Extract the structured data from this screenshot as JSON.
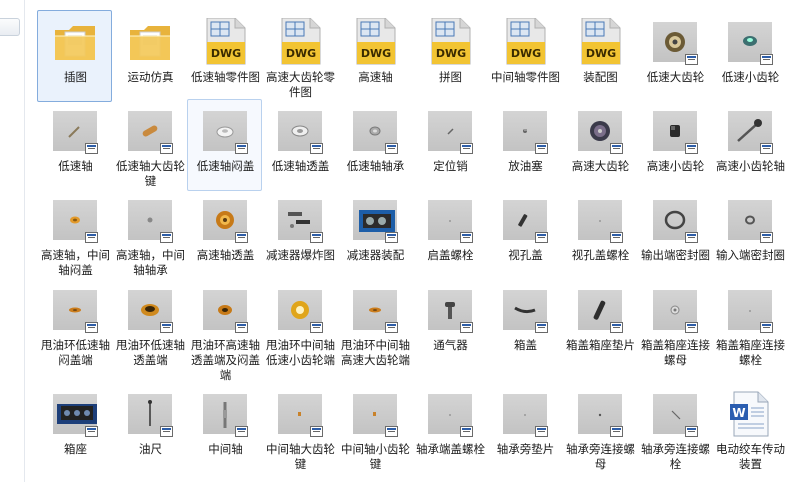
{
  "files": [
    {
      "label": "插图",
      "icon": "folder-icon",
      "kind": "folder"
    },
    {
      "label": "运动仿真",
      "icon": "folder-icon",
      "kind": "folder"
    },
    {
      "label": "低速轴零件图",
      "icon": "dwg-file-icon",
      "kind": "dwg"
    },
    {
      "label": "高速大齿轮零件图",
      "icon": "dwg-file-icon",
      "kind": "dwg"
    },
    {
      "label": "高速轴",
      "icon": "dwg-file-icon",
      "kind": "dwg"
    },
    {
      "label": "拼图",
      "icon": "dwg-file-icon",
      "kind": "dwg"
    },
    {
      "label": "中间轴零件图",
      "icon": "dwg-file-icon",
      "kind": "dwg"
    },
    {
      "label": "装配图",
      "icon": "dwg-file-icon",
      "kind": "dwg"
    },
    {
      "label": "低速大齿轮",
      "icon": "gear-part-icon",
      "kind": "part",
      "shape": "gear"
    },
    {
      "label": "低速小齿轮",
      "icon": "gear-part-icon",
      "kind": "part",
      "shape": "smallgear"
    },
    {
      "label": "低速轴",
      "icon": "shaft-part-icon",
      "kind": "part",
      "shape": "shaft"
    },
    {
      "label": "低速轴大齿轮键",
      "icon": "key-part-icon",
      "kind": "part",
      "shape": "key"
    },
    {
      "label": "低速轴闷盖",
      "icon": "cap-part-icon",
      "kind": "part",
      "shape": "cap"
    },
    {
      "label": "低速轴透盖",
      "icon": "cap-part-icon",
      "kind": "part",
      "shape": "ring"
    },
    {
      "label": "低速轴轴承",
      "icon": "bearing-part-icon",
      "kind": "part",
      "shape": "bearing"
    },
    {
      "label": "定位销",
      "icon": "pin-part-icon",
      "kind": "part",
      "shape": "pin"
    },
    {
      "label": "放油塞",
      "icon": "plug-part-icon",
      "kind": "part",
      "shape": "plug"
    },
    {
      "label": "高速大齿轮",
      "icon": "gear-part-icon",
      "kind": "part",
      "shape": "gear2"
    },
    {
      "label": "高速小齿轮",
      "icon": "gear-part-icon",
      "kind": "part",
      "shape": "block"
    },
    {
      "label": "高速小齿轮轴",
      "icon": "shaft-part-icon",
      "kind": "part",
      "shape": "gearshaft"
    },
    {
      "label": "高速轴，中间轴闷盖",
      "icon": "cap-part-icon",
      "kind": "part",
      "shape": "orangedot"
    },
    {
      "label": "高速轴，中间轴轴承",
      "icon": "bearing-part-icon",
      "kind": "part",
      "shape": "smalldot"
    },
    {
      "label": "高速轴透盖",
      "icon": "cap-part-icon",
      "kind": "part",
      "shape": "orangering"
    },
    {
      "label": "减速器爆炸图",
      "icon": "assembly-icon",
      "kind": "part",
      "shape": "explode"
    },
    {
      "label": "减速器装配",
      "icon": "assembly-icon",
      "kind": "part",
      "shape": "assembly"
    },
    {
      "label": "启盖螺栓",
      "icon": "bolt-part-icon",
      "kind": "part",
      "shape": "tiny"
    },
    {
      "label": "视孔盖",
      "icon": "cover-part-icon",
      "kind": "part",
      "shape": "slash"
    },
    {
      "label": "视孔盖螺栓",
      "icon": "bolt-part-icon",
      "kind": "part",
      "shape": "tiny"
    },
    {
      "label": "输出端密封圈",
      "icon": "seal-part-icon",
      "kind": "part",
      "shape": "seal"
    },
    {
      "label": "输入端密封圈",
      "icon": "seal-part-icon",
      "kind": "part",
      "shape": "sealsmall"
    },
    {
      "label": "甩油环低速轴闷盖端",
      "icon": "ring-part-icon",
      "kind": "part",
      "shape": "orangeflat"
    },
    {
      "label": "甩油环低速轴透盖端",
      "icon": "ring-part-icon",
      "kind": "part",
      "shape": "orangeflat2"
    },
    {
      "label": "甩油环高速轴透盖端及闷盖端",
      "icon": "ring-part-icon",
      "kind": "part",
      "shape": "orangering2"
    },
    {
      "label": "甩油环中间轴低速小齿轮端",
      "icon": "ring-part-icon",
      "kind": "part",
      "shape": "yellowring"
    },
    {
      "label": "甩油环中间轴高速大齿轮端",
      "icon": "ring-part-icon",
      "kind": "part",
      "shape": "orangeflat"
    },
    {
      "label": "通气器",
      "icon": "vent-part-icon",
      "kind": "part",
      "shape": "vent"
    },
    {
      "label": "箱盖",
      "icon": "housing-part-icon",
      "kind": "part",
      "shape": "lid"
    },
    {
      "label": "箱盖箱座垫片",
      "icon": "gasket-part-icon",
      "kind": "part",
      "shape": "gasket"
    },
    {
      "label": "箱盖箱座连接螺母",
      "icon": "nut-part-icon",
      "kind": "part",
      "shape": "nut"
    },
    {
      "label": "箱盖箱座连接螺栓",
      "icon": "bolt-part-icon",
      "kind": "part",
      "shape": "tiny"
    },
    {
      "label": "箱座",
      "icon": "housing-part-icon",
      "kind": "part",
      "shape": "base"
    },
    {
      "label": "油尺",
      "icon": "dipstick-part-icon",
      "kind": "part",
      "shape": "dipstick"
    },
    {
      "label": "中间轴",
      "icon": "shaft-part-icon",
      "kind": "part",
      "shape": "midshaft"
    },
    {
      "label": "中间轴大齿轮键",
      "icon": "key-part-icon",
      "kind": "part",
      "shape": "orangebit"
    },
    {
      "label": "中间轴小齿轮键",
      "icon": "key-part-icon",
      "kind": "part",
      "shape": "orangebit"
    },
    {
      "label": "轴承端盖螺栓",
      "icon": "bolt-part-icon",
      "kind": "part",
      "shape": "tiny"
    },
    {
      "label": "轴承旁垫片",
      "icon": "washer-part-icon",
      "kind": "part",
      "shape": "tiny"
    },
    {
      "label": "轴承旁连接螺母",
      "icon": "nut-part-icon",
      "kind": "part",
      "shape": "tinydark"
    },
    {
      "label": "轴承旁连接螺栓",
      "icon": "bolt-part-icon",
      "kind": "part",
      "shape": "boltline"
    },
    {
      "label": "电动绞车传动装置",
      "icon": "word-doc-icon",
      "kind": "doc"
    }
  ],
  "selected_index": 0,
  "hover_index": 12
}
